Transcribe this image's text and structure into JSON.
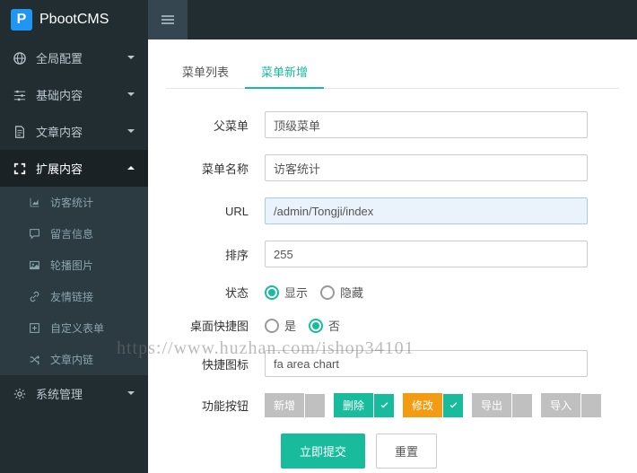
{
  "brand": "PbootCMS",
  "sidebar": {
    "items": [
      {
        "label": "全局配置"
      },
      {
        "label": "基础内容"
      },
      {
        "label": "文章内容"
      },
      {
        "label": "扩展内容"
      },
      {
        "label": "系统管理"
      }
    ],
    "sub": [
      {
        "label": "访客统计"
      },
      {
        "label": "留言信息"
      },
      {
        "label": "轮播图片"
      },
      {
        "label": "友情链接"
      },
      {
        "label": "自定义表单"
      },
      {
        "label": "文章内链"
      }
    ]
  },
  "tabs": {
    "list": "菜单列表",
    "add": "菜单新增"
  },
  "form": {
    "parent_lbl": "父菜单",
    "parent_val": "顶级菜单",
    "name_lbl": "菜单名称",
    "name_val": "访客统计",
    "url_lbl": "URL",
    "url_val": "/admin/Tongji/index",
    "sort_lbl": "排序",
    "sort_val": "255",
    "status_lbl": "状态",
    "status_show": "显示",
    "status_hide": "隐藏",
    "shortcut_lbl": "桌面快捷图",
    "yes": "是",
    "no": "否",
    "icon_lbl": "快捷图标",
    "icon_val": "fa area chart",
    "fn_lbl": "功能按钮",
    "fn": {
      "add": "新增",
      "del": "删除",
      "mod": "修改",
      "exp": "导出",
      "imp": "导入"
    },
    "submit": "立即提交",
    "reset": "重置"
  }
}
